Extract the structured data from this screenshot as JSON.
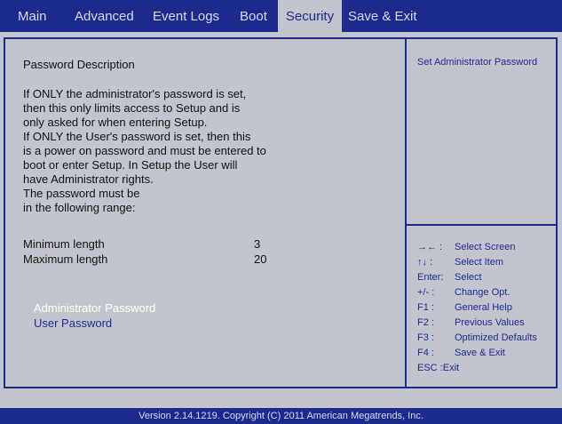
{
  "tabs": [
    {
      "label": "Main",
      "active": false
    },
    {
      "label": "Advanced",
      "active": false
    },
    {
      "label": "Event Logs",
      "active": false
    },
    {
      "label": "Boot",
      "active": false
    },
    {
      "label": "Security",
      "active": true
    },
    {
      "label": "Save & Exit",
      "active": false
    }
  ],
  "main": {
    "description_title": "Password Description",
    "description_lines": [
      "If ONLY the administrator's password is set,",
      "then this only limits access to Setup and is",
      "only asked for when entering Setup.",
      "If ONLY the User's password is set, then this",
      "is a power on password and must be entered to",
      "boot or enter Setup.  In Setup the User will",
      "have Administrator rights.",
      "The password must be",
      "in the following range:"
    ],
    "range": [
      {
        "label": "Minimum length",
        "value": "3"
      },
      {
        "label": "Maximum length",
        "value": "20"
      }
    ],
    "menu_items": [
      {
        "label": "Administrator Password",
        "selected": true
      },
      {
        "label": "User Password",
        "selected": false
      }
    ]
  },
  "help": {
    "text": "Set Administrator Password",
    "keys": [
      {
        "key": "→← :",
        "desc": "Select Screen"
      },
      {
        "key": "↑↓ :",
        "desc": "Select Item"
      },
      {
        "key": "Enter:",
        "desc": "Select"
      },
      {
        "key": "+/- :",
        "desc": "Change Opt."
      },
      {
        "key": "F1 :",
        "desc": "General Help"
      },
      {
        "key": "F2 :",
        "desc": "Previous Values"
      },
      {
        "key": "F3 :",
        "desc": "Optimized Defaults"
      },
      {
        "key": "F4 :",
        "desc": "Save & Exit"
      },
      {
        "key": "ESC :Exit",
        "desc": ""
      }
    ]
  },
  "footer": "Version 2.14.1219. Copyright (C) 2011 American Megatrends, Inc.",
  "colors": {
    "bar": "#1c2a8e",
    "panel": "#c3c5ce",
    "selected_text": "#ffffff",
    "help_text": "#1c2a8e"
  }
}
